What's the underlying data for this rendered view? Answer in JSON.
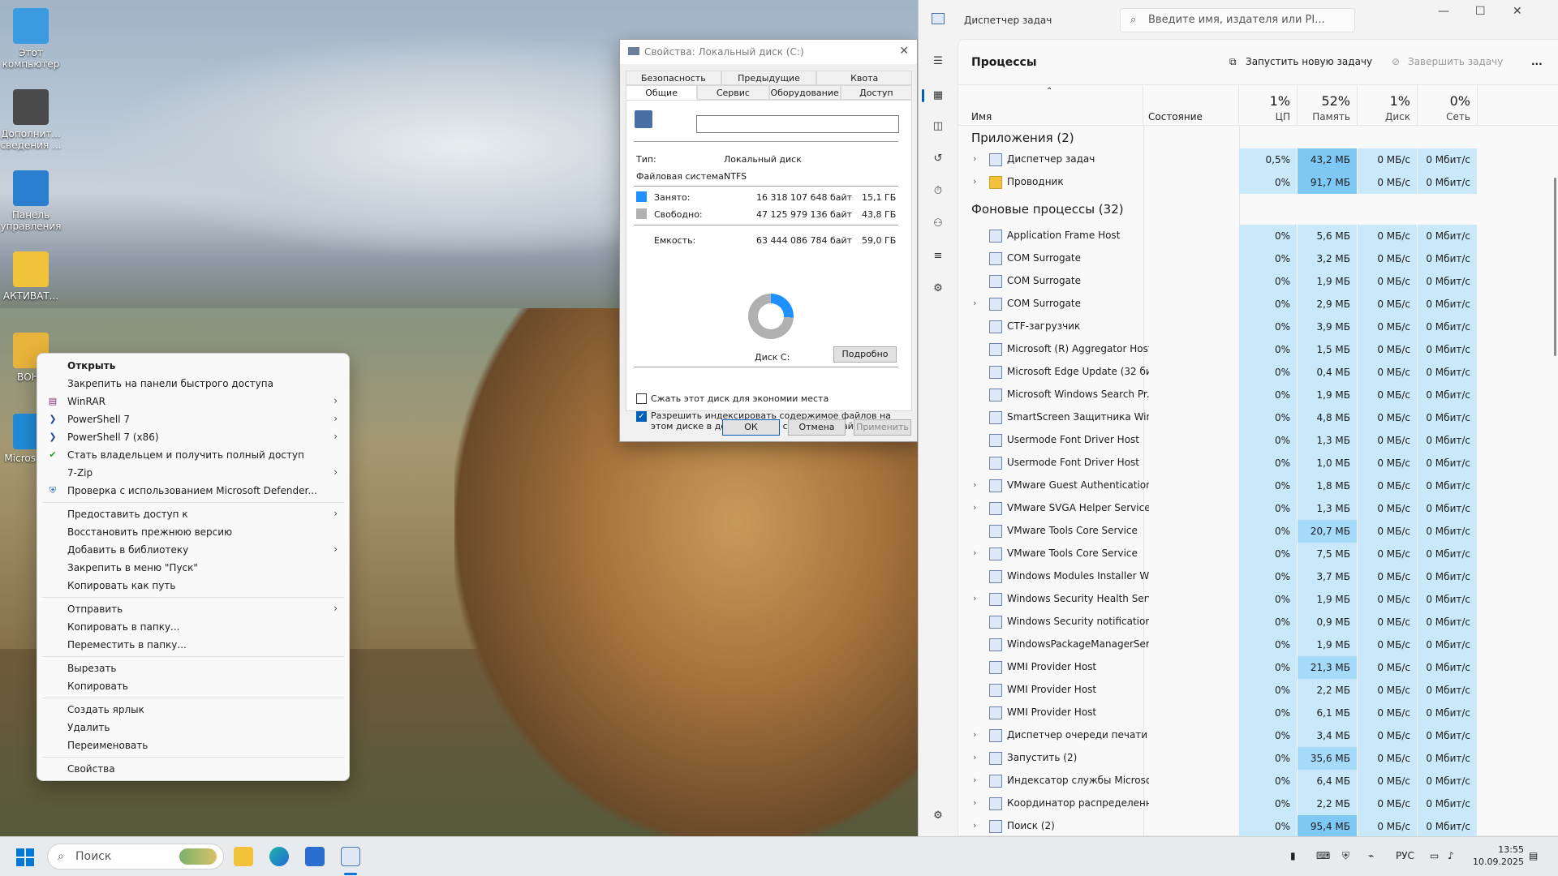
{
  "desktop": {
    "icons": [
      {
        "label": "Этот компьютер",
        "color": "#3a9be0"
      },
      {
        "label": "Дополнит... сведения ...",
        "color": "#4a4a4a"
      },
      {
        "label": "Панель управления",
        "color": "#2a7fd0"
      },
      {
        "label": "АКТИВАТ...",
        "color": "#f2c23a"
      },
      {
        "label": "ВОНУ",
        "color": "#e8b33a"
      },
      {
        "label": "Micros Edg",
        "color": "#1f8bd6"
      }
    ]
  },
  "context_menu": {
    "items": [
      {
        "label": "Открыть",
        "bold": true,
        "icon": "",
        "submenu": false
      },
      {
        "label": "Закрепить на панели быстрого доступа",
        "icon": "",
        "submenu": false
      },
      {
        "label": "WinRAR",
        "icon": "winrar-icon",
        "submenu": true
      },
      {
        "label": "PowerShell 7",
        "icon": "powershell-icon",
        "submenu": true
      },
      {
        "label": "PowerShell 7 (x86)",
        "icon": "powershell-icon",
        "submenu": true
      },
      {
        "label": "Стать владельцем и получить полный доступ",
        "icon": "shield-check-icon",
        "submenu": false
      },
      {
        "label": "7-Zip",
        "icon": "",
        "submenu": true
      },
      {
        "label": "Проверка с использованием Microsoft Defender...",
        "icon": "defender-icon",
        "submenu": false
      },
      {
        "sep": true
      },
      {
        "label": "Предоставить доступ к",
        "icon": "",
        "submenu": true
      },
      {
        "label": "Восстановить прежнюю версию",
        "icon": "",
        "submenu": false
      },
      {
        "label": "Добавить в библиотеку",
        "icon": "",
        "submenu": true
      },
      {
        "label": "Закрепить в меню \"Пуск\"",
        "icon": "",
        "submenu": false
      },
      {
        "label": "Копировать как путь",
        "icon": "",
        "submenu": false
      },
      {
        "sep": true
      },
      {
        "label": "Отправить",
        "icon": "",
        "submenu": true
      },
      {
        "label": "Копировать в папку...",
        "icon": "",
        "submenu": false
      },
      {
        "label": "Переместить в папку...",
        "icon": "",
        "submenu": false
      },
      {
        "sep": true
      },
      {
        "label": "Вырезать",
        "icon": "",
        "submenu": false
      },
      {
        "label": "Копировать",
        "icon": "",
        "submenu": false
      },
      {
        "sep": true
      },
      {
        "label": "Создать ярлык",
        "icon": "",
        "submenu": false
      },
      {
        "label": "Удалить",
        "icon": "",
        "submenu": false
      },
      {
        "label": "Переименовать",
        "icon": "",
        "submenu": false
      },
      {
        "sep": true
      },
      {
        "label": "Свойства",
        "icon": "",
        "submenu": false
      }
    ]
  },
  "props": {
    "title": "Свойства: Локальный диск (C:)",
    "tabs_top": [
      "Безопасность",
      "Предыдущие версии",
      "Квота"
    ],
    "tabs_bottom": [
      "Общие",
      "Сервис",
      "Оборудование",
      "Доступ"
    ],
    "name_value": "",
    "type_label": "Тип:",
    "type_value": "Локальный диск",
    "fs_label": "Файловая система:",
    "fs_value": "NTFS",
    "used_label": "Занято:",
    "used_bytes": "16 318 107 648 байт",
    "used_size": "15,1 ГБ",
    "free_label": "Свободно:",
    "free_bytes": "47 125 979 136 байт",
    "free_size": "43,8 ГБ",
    "cap_label": "Емкость:",
    "cap_bytes": "63 444 086 784 байт",
    "cap_size": "59,0 ГБ",
    "used_fraction": 0.257,
    "used_color": "#1e90ff",
    "free_color": "#b0b0b0",
    "disk_label": "Диск C:",
    "details_btn": "Подробно",
    "compress_label": "Сжать этот диск для экономии места",
    "compress_checked": false,
    "index_label": "Разрешить индексировать содержимое файлов на этом диске в дополнение к свойствам файла",
    "index_checked": true,
    "ok": "ОК",
    "cancel": "Отмена",
    "apply": "Применить"
  },
  "taskman": {
    "app_name": "Диспетчер задач",
    "search_placeholder": "Введите имя, издателя или PI...",
    "page_title": "Процессы",
    "run_task": "Запустить новую задачу",
    "end_task": "Завершить задачу",
    "more": "...",
    "columns": {
      "name": "Имя",
      "status": "Состояние",
      "cpu_pct": "1%",
      "cpu": "ЦП",
      "mem_pct": "52%",
      "mem": "Память",
      "disk_pct": "1%",
      "disk": "Диск",
      "net_pct": "0%",
      "net": "Сеть"
    },
    "group_apps": "Приложения (2)",
    "group_bg": "Фоновые процессы (32)",
    "apps": [
      {
        "name": "Диспетчер задач",
        "cpu": "0,5%",
        "mem": "43,2 МБ",
        "disk": "0 МБ/с",
        "net": "0 Мбит/с",
        "exp": true,
        "icon": "taskmgr-icon"
      },
      {
        "name": "Проводник",
        "cpu": "0%",
        "mem": "91,7 МБ",
        "disk": "0 МБ/с",
        "net": "0 Мбит/с",
        "exp": true,
        "icon": "folder-icon"
      }
    ],
    "bg": [
      {
        "name": "Application Frame Host",
        "cpu": "0%",
        "mem": "5,6 МБ",
        "disk": "0 МБ/с",
        "net": "0 Мбит/с",
        "exp": false
      },
      {
        "name": "COM Surrogate",
        "cpu": "0%",
        "mem": "3,2 МБ",
        "disk": "0 МБ/с",
        "net": "0 Мбит/с",
        "exp": false
      },
      {
        "name": "COM Surrogate",
        "cpu": "0%",
        "mem": "1,9 МБ",
        "disk": "0 МБ/с",
        "net": "0 Мбит/с",
        "exp": false
      },
      {
        "name": "COM Surrogate",
        "cpu": "0%",
        "mem": "2,9 МБ",
        "disk": "0 МБ/с",
        "net": "0 Мбит/с",
        "exp": true
      },
      {
        "name": "CTF-загрузчик",
        "cpu": "0%",
        "mem": "3,9 МБ",
        "disk": "0 МБ/с",
        "net": "0 Мбит/с",
        "exp": false
      },
      {
        "name": "Microsoft (R) Aggregator Host",
        "cpu": "0%",
        "mem": "1,5 МБ",
        "disk": "0 МБ/с",
        "net": "0 Мбит/с",
        "exp": false
      },
      {
        "name": "Microsoft Edge Update (32 би...",
        "cpu": "0%",
        "mem": "0,4 МБ",
        "disk": "0 МБ/с",
        "net": "0 Мбит/с",
        "exp": false
      },
      {
        "name": "Microsoft Windows Search Pr...",
        "cpu": "0%",
        "mem": "1,9 МБ",
        "disk": "0 МБ/с",
        "net": "0 Мбит/с",
        "exp": false
      },
      {
        "name": "SmartScreen Защитника Win...",
        "cpu": "0%",
        "mem": "4,8 МБ",
        "disk": "0 МБ/с",
        "net": "0 Мбит/с",
        "exp": false
      },
      {
        "name": "Usermode Font Driver Host",
        "cpu": "0%",
        "mem": "1,3 МБ",
        "disk": "0 МБ/с",
        "net": "0 Мбит/с",
        "exp": false
      },
      {
        "name": "Usermode Font Driver Host",
        "cpu": "0%",
        "mem": "1,0 МБ",
        "disk": "0 МБ/с",
        "net": "0 Мбит/с",
        "exp": false
      },
      {
        "name": "VMware Guest Authentication...",
        "cpu": "0%",
        "mem": "1,8 МБ",
        "disk": "0 МБ/с",
        "net": "0 Мбит/с",
        "exp": true
      },
      {
        "name": "VMware SVGA Helper Service (...",
        "cpu": "0%",
        "mem": "1,3 МБ",
        "disk": "0 МБ/с",
        "net": "0 Мбит/с",
        "exp": true
      },
      {
        "name": "VMware Tools Core Service",
        "cpu": "0%",
        "mem": "20,7 МБ",
        "disk": "0 МБ/с",
        "net": "0 Мбит/с",
        "exp": false
      },
      {
        "name": "VMware Tools Core Service",
        "cpu": "0%",
        "mem": "7,5 МБ",
        "disk": "0 МБ/с",
        "net": "0 Мбит/с",
        "exp": true
      },
      {
        "name": "Windows Modules Installer W...",
        "cpu": "0%",
        "mem": "3,7 МБ",
        "disk": "0 МБ/с",
        "net": "0 Мбит/с",
        "exp": false
      },
      {
        "name": "Windows Security Health Servi...",
        "cpu": "0%",
        "mem": "1,9 МБ",
        "disk": "0 МБ/с",
        "net": "0 Мбит/с",
        "exp": true
      },
      {
        "name": "Windows Security notification...",
        "cpu": "0%",
        "mem": "0,9 МБ",
        "disk": "0 МБ/с",
        "net": "0 Мбит/с",
        "exp": false
      },
      {
        "name": "WindowsPackageManagerSer...",
        "cpu": "0%",
        "mem": "1,9 МБ",
        "disk": "0 МБ/с",
        "net": "0 Мбит/с",
        "exp": false
      },
      {
        "name": "WMI Provider Host",
        "cpu": "0%",
        "mem": "21,3 МБ",
        "disk": "0 МБ/с",
        "net": "0 Мбит/с",
        "exp": false
      },
      {
        "name": "WMI Provider Host",
        "cpu": "0%",
        "mem": "2,2 МБ",
        "disk": "0 МБ/с",
        "net": "0 Мбит/с",
        "exp": false
      },
      {
        "name": "WMI Provider Host",
        "cpu": "0%",
        "mem": "6,1 МБ",
        "disk": "0 МБ/с",
        "net": "0 Мбит/с",
        "exp": false
      },
      {
        "name": "Диспетчер очереди печати",
        "cpu": "0%",
        "mem": "3,4 МБ",
        "disk": "0 МБ/с",
        "net": "0 Мбит/с",
        "exp": true
      },
      {
        "name": "Запустить (2)",
        "cpu": "0%",
        "mem": "35,6 МБ",
        "disk": "0 МБ/с",
        "net": "0 Мбит/с",
        "exp": true
      },
      {
        "name": "Индексатор службы Microso...",
        "cpu": "0%",
        "mem": "6,4 МБ",
        "disk": "0 МБ/с",
        "net": "0 Мбит/с",
        "exp": true
      },
      {
        "name": "Координатор распределенн...",
        "cpu": "0%",
        "mem": "2,2 МБ",
        "disk": "0 МБ/с",
        "net": "0 Мбит/с",
        "exp": true
      },
      {
        "name": "Поиск (2)",
        "cpu": "0%",
        "mem": "95,4 МБ",
        "disk": "0 МБ/с",
        "net": "0 Мбит/с",
        "exp": true
      }
    ]
  },
  "taskbar": {
    "search": "Поиск",
    "lang": "РУС",
    "time": "13:55",
    "date": "10.09.2025"
  }
}
